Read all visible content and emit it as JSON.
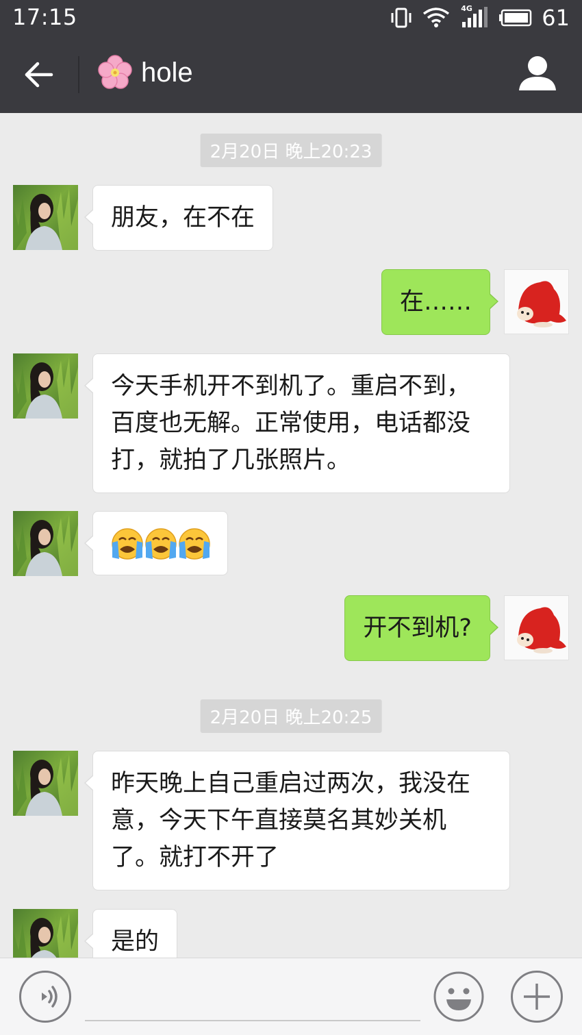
{
  "status_bar": {
    "time": "17:15",
    "network": "4G",
    "battery": "61",
    "icons": [
      "vibrate-icon",
      "wifi-icon",
      "signal-icon",
      "battery-icon"
    ]
  },
  "header": {
    "title": "hole",
    "title_prefix_icon": "cherry-blossom-icon",
    "back_icon": "back-arrow-icon",
    "profile_icon": "person-icon"
  },
  "messages": [
    {
      "type": "timestamp",
      "text": "2月20日 晚上20:23"
    },
    {
      "type": "in",
      "lines": [
        "朋友，在不在"
      ]
    },
    {
      "type": "out",
      "lines": [
        "在……"
      ]
    },
    {
      "type": "in",
      "lines": [
        "今天手机开不到机了。重启不到，",
        "百度也无解。正常使用，电话都没",
        "打，就拍了几张照片。"
      ]
    },
    {
      "type": "in",
      "lines": [
        "😭😭😭"
      ]
    },
    {
      "type": "out",
      "lines": [
        "开不到机?"
      ]
    },
    {
      "type": "timestamp",
      "text": "2月20日 晚上20:25"
    },
    {
      "type": "in",
      "lines": [
        "昨天晚上自己重启过两次，我没在",
        "意，今天下午直接莫名其妙关机",
        "了。就打不开了"
      ]
    },
    {
      "type": "in",
      "lines": [
        "是的"
      ]
    }
  ],
  "composer": {
    "voice_icon": "voice-icon",
    "emoji_icon": "emoji-icon",
    "plus_icon": "plus-icon",
    "input_value": ""
  },
  "colors": {
    "header_bg": "#3a3a3f",
    "chat_bg": "#ebebeb",
    "outgoing_bubble": "#9ee65a",
    "incoming_bubble": "#ffffff"
  }
}
